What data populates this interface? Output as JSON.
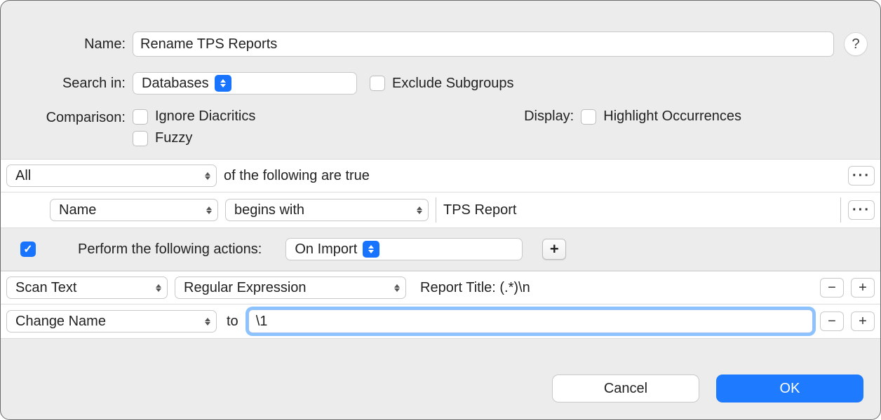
{
  "header": {
    "name_label": "Name:",
    "name_value": "Rename TPS Reports",
    "help_tooltip": "?"
  },
  "search": {
    "label": "Search in:",
    "selected": "Databases",
    "exclude_label": "Exclude Subgroups",
    "exclude_checked": false
  },
  "comparison": {
    "label": "Comparison:",
    "options": [
      {
        "label": "Ignore Diacritics",
        "checked": false
      },
      {
        "label": "Fuzzy",
        "checked": false
      }
    ]
  },
  "display": {
    "label": "Display:",
    "highlight_label": "Highlight Occurrences",
    "highlight_checked": false
  },
  "predicate": {
    "quantifier": "All",
    "suffix_text": "of the following are true",
    "conditions": [
      {
        "field": "Name",
        "operator": "begins with",
        "value": "TPS Report"
      }
    ]
  },
  "actions": {
    "enabled": true,
    "header_label": "Perform the following actions:",
    "trigger": "On Import",
    "rows": [
      {
        "kind": "scan",
        "action": "Scan Text",
        "mode": "Regular Expression",
        "pattern": "Report Title: (.*)\\n"
      },
      {
        "kind": "change",
        "action": "Change Name",
        "to_label": "to",
        "value": "\\1",
        "focused": true
      }
    ]
  },
  "footer": {
    "cancel": "Cancel",
    "ok": "OK"
  }
}
